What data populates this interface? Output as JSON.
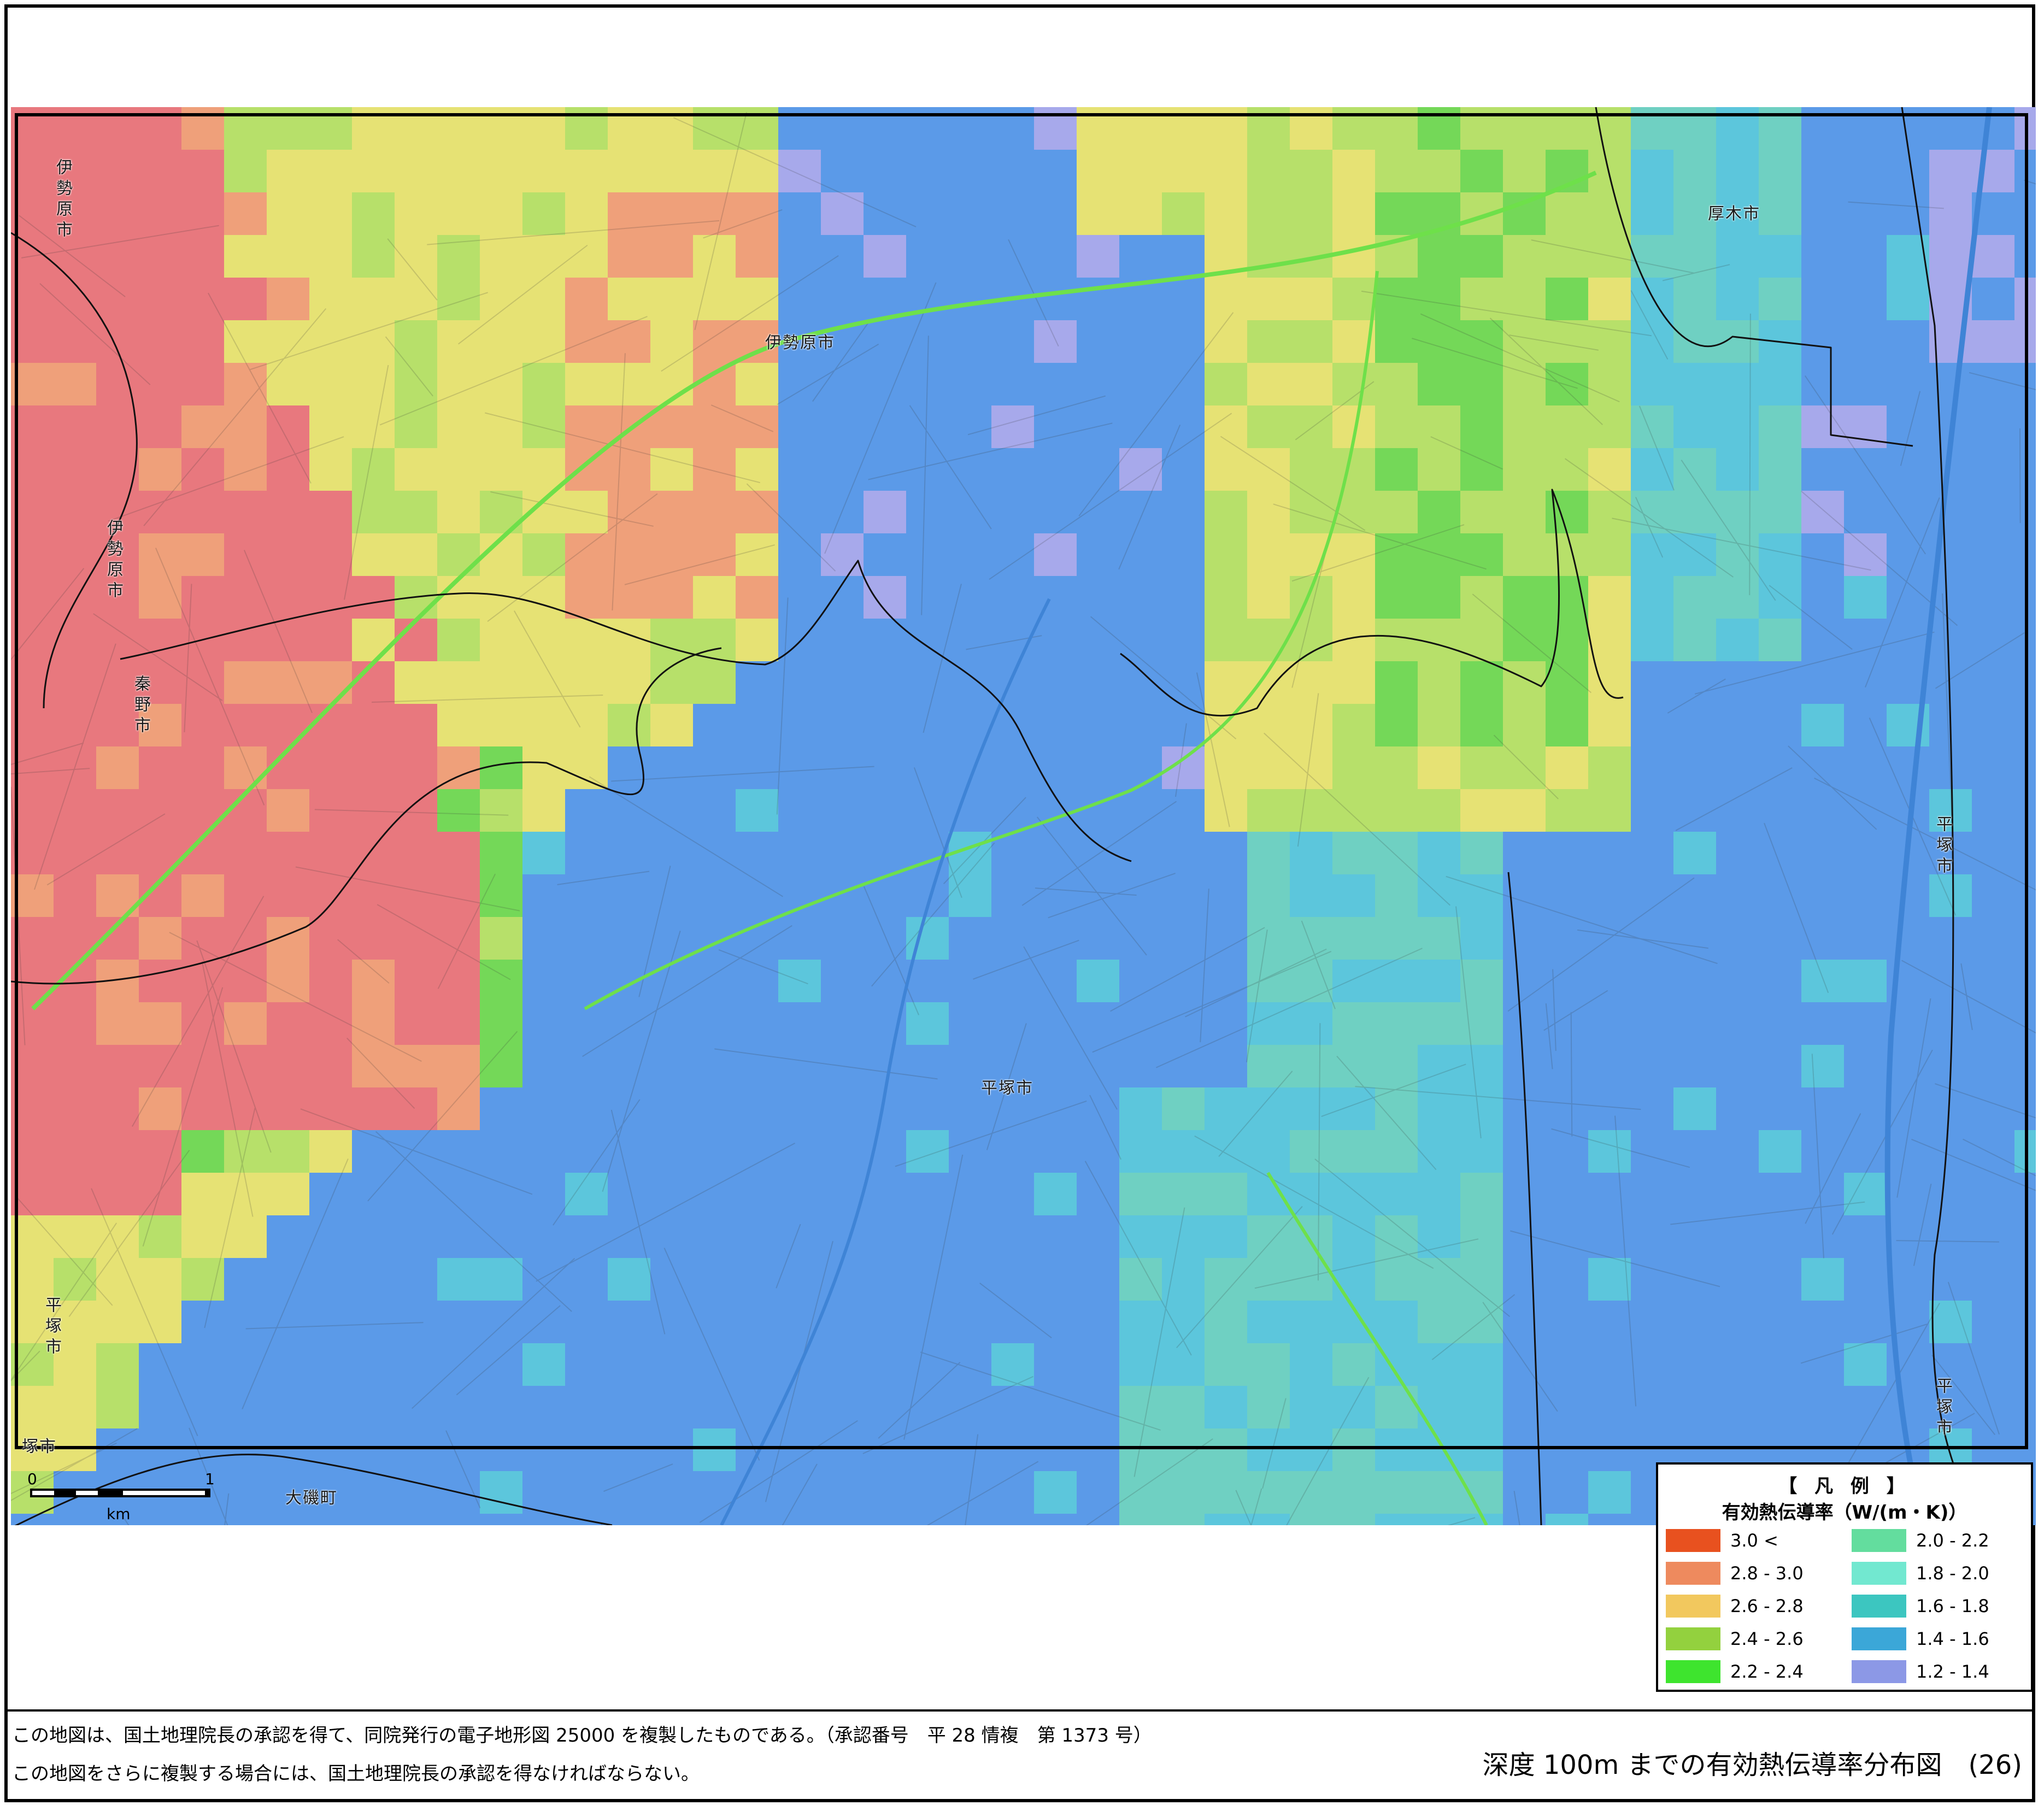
{
  "city_labels": {
    "isehara_top": "伊勢原市",
    "isehara_center": "伊勢原市",
    "isehara_left": "伊勢原市",
    "hadano": "秦野市",
    "atsugi": "厚木市",
    "hiratsuka_center": "平塚市",
    "hiratsuka_right": "平塚市",
    "hiratsuka_left": "平塚市",
    "hiratsuka_bottom_right": "平塚市",
    "oiso": "大磯町",
    "cut_label": "塚市"
  },
  "scale_bar": {
    "zero": "0",
    "one": "1",
    "unit": "km"
  },
  "legend": {
    "title": "【 凡 例 】",
    "subtitle": "有効熱伝導率（W/(m・K)）",
    "classes": [
      {
        "label": "3.0  <",
        "color": "#E8511F"
      },
      {
        "label": "2.8 ‐ 3.0",
        "color": "#EE8A5E"
      },
      {
        "label": "2.6 ‐ 2.8",
        "color": "#F2C85E"
      },
      {
        "label": "2.4 ‐ 2.6",
        "color": "#93D13E"
      },
      {
        "label": "2.2 ‐ 2.4",
        "color": "#3EE42E"
      },
      {
        "label": "2.0 ‐ 2.2",
        "color": "#63DD9E"
      },
      {
        "label": "1.8 ‐ 2.0",
        "color": "#72E8D0"
      },
      {
        "label": "1.6 ‐ 1.8",
        "color": "#3CC6C0"
      },
      {
        "label": "1.4 ‐ 1.6",
        "color": "#3BA7D8"
      },
      {
        "label": "1.2 ‐ 1.4",
        "color": "#8C98E6"
      }
    ]
  },
  "map_colors": {
    "red": "#E8787E",
    "orange": "#EFA07A",
    "yellow": "#E6E274",
    "lime": "#B7E06A",
    "green": "#74D858",
    "teal": "#6FD0C2",
    "cyan": "#5CC6DC",
    "blue": "#5B9AE8",
    "violet": "#A7A9EB",
    "boundary": "#111111",
    "river": "#3F84D6",
    "expressway": "#6EE04A"
  },
  "footer": {
    "notice_1": "この地図は、国土地理院長の承認を得て、同院発行の電子地形図 25000 を複製したものである。（承認番号　平 28 情複　第 1373 号）",
    "notice_2": "この地図をさらに複製する場合には、国土地理院長の承認を得なければならない。",
    "map_title": "深度 100m までの有効熱伝導率分布図　(26)"
  }
}
